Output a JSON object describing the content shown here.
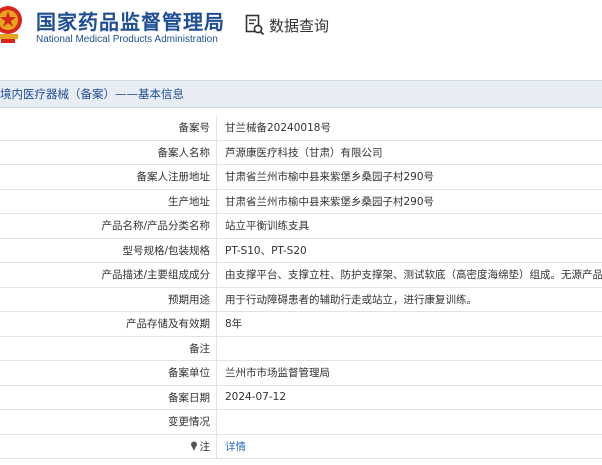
{
  "header": {
    "brand_cn": "国家药品监督管理局",
    "brand_en": "National Medical Products Administration",
    "query_label": "数据查询",
    "emblem_icon": "national-emblem-icon",
    "query_icon": "document-search-icon"
  },
  "section": {
    "title": "境内医疗器械（备案）——基本信息"
  },
  "rows": [
    {
      "key": "备案号",
      "value": "甘兰械备20240018号"
    },
    {
      "key": "备案人名称",
      "value": "芦源康医疗科技（甘肃）有限公司"
    },
    {
      "key": "备案人注册地址",
      "value": "甘肃省兰州市榆中县来紫堡乡桑园子村290号"
    },
    {
      "key": "生产地址",
      "value": "甘肃省兰州市榆中县来紫堡乡桑园子村290号"
    },
    {
      "key": "产品名称/产品分类名称",
      "value": "站立平衡训练支具"
    },
    {
      "key": "型号规格/包装规格",
      "value": "PT-S10、PT-S20"
    },
    {
      "key": "产品描述/主要组成成分",
      "value": "由支撑平台、支撑立柱、防护支撑架、测试软底（高密度海绵垫）组成。无源产品。"
    },
    {
      "key": "预期用途",
      "value": "用于行动障碍患者的辅助行走或站立，进行康复训练。"
    },
    {
      "key": "产品存储及有效期",
      "value": "8年"
    },
    {
      "key": "备注",
      "value": ""
    },
    {
      "key": "备案单位",
      "value": "兰州市市场监督管理局"
    },
    {
      "key": "备案日期",
      "value": "2024-07-12"
    },
    {
      "key": "变更情况",
      "value": ""
    },
    {
      "key": "注",
      "value": "详情",
      "key_icon": "pin-icon"
    }
  ],
  "colors": {
    "brand": "#1f4e96",
    "section_bg": "#e8edf4",
    "link": "#2a6fc9"
  }
}
